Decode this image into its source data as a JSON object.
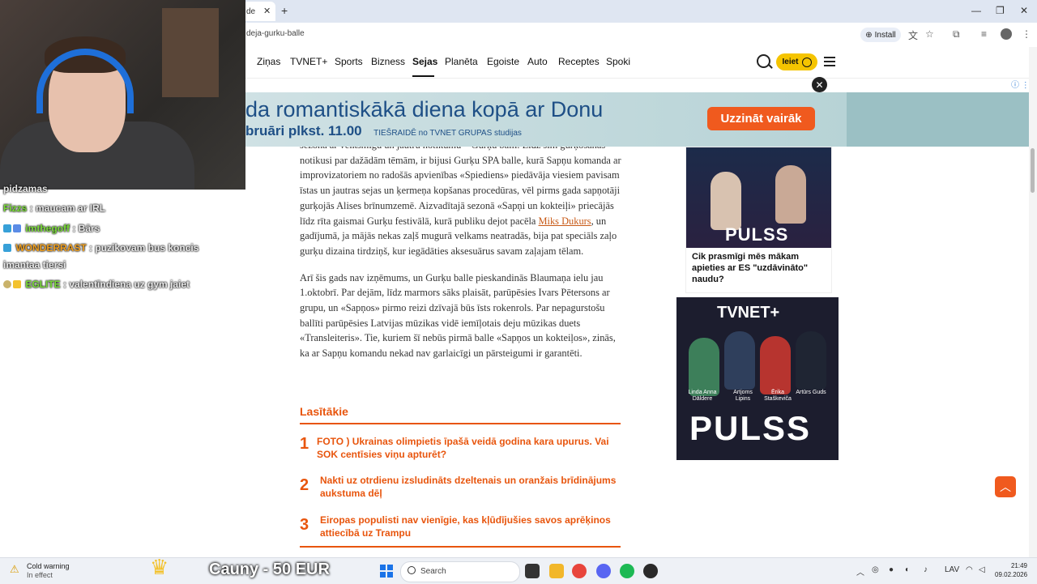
{
  "browser": {
    "tab_title": "de",
    "tab_close": "✕",
    "new_tab": "+",
    "url": "deja-gurku-balle",
    "install_label": "Install",
    "window_controls": [
      "—",
      "❐",
      "✕"
    ]
  },
  "nav": {
    "items": [
      "Ziņas",
      "TVNET+",
      "Sports",
      "Bizness",
      "Sejas",
      "Planēta",
      "Egoiste",
      "Auto",
      "Receptes",
      "Spoki"
    ],
    "active": "Sejas",
    "login_label": "Ieiet"
  },
  "ad_banner": {
    "title": "da romantiskākā diena kopā ar Donu",
    "date": "bruāri plkst. 11.00",
    "live_text": "TIEŠRAIDĒ no TVNET GRUPAS studijas",
    "button": "Uzzināt vairāk",
    "close": "✕",
    "info": "ⓘ ⋮"
  },
  "article": {
    "p1_a": "sezonā ar veiksmīgu un jautru notikumu – Gurķu balli. Līdz šim gurķošanās notikusi par dažādām tēmām, ir bijusi Gurķu SPA balle, kurā Sapņu komanda ar improvizatoriem no radošās apvienības «Spiediens» piedāvāja viesiem pavisam īstas un jautras sejas un ķermeņa kopšanas procedūras, vēl pirms gada sapņotāji gurķojās Alises brīnumzemē. Aizvadītajā sezonā «Sapņi un kokteiļi» priecājās līdz rīta gaismai Gurķu festivālā, kurā publiku dejot pacēla ",
    "p1_link": "Miks Dukurs",
    "p1_b": ", un gadījumā, ja mājās nekas zaļš mugurā velkams neatradās, bija pat speciāls zaļo gurķu dizaina tirdziņš, kur iegādāties aksesuārus savam zaļajam tēlam.",
    "p2": "Arī šis gads nav izņēmums, un Gurķu balle pieskandinās Blaumaņa ielu jau 1.oktobrī. Par dejām, līdz marmors sāks plaisāt, parūpēsies Ivars Pētersons ar grupu, un «Sapņos» pirmo reizi dzīvajā būs īsts rokenrols. Par nepagurstošu ballīti parūpēsies Latvijas mūzikas vidē iemīļotais deju mūzikas duets «Transleiteris». Tie, kuriem šī nebūs pirmā balle «Sapņos un kokteiļos», zinās, ka ar Sapņu komandu nekad nav garlaicīgi un pārsteigumi ir garantēti."
  },
  "most_read": {
    "title": "Lasītākie",
    "items": [
      {
        "num": "1",
        "text": "FOTO ) Ukrainas olimpietis īpašā veidā godina kara upurus. Vai SOK centīsies viņu apturēt?"
      },
      {
        "num": "2",
        "text": "Nakti uz otrdienu izsludināts dzeltenais un oranžais brīdinājums aukstuma dēļ"
      },
      {
        "num": "3",
        "text": "Eiropas populisti nav vienīgie, kas kļūdījušies savos aprēķinos attiecībā uz Trampu"
      }
    ]
  },
  "sidebar": {
    "promo1_logo": "PULSS",
    "promo1_caption": "Cik prasmīgi mēs mākam apieties ar ES \"uzdāvināto\" naudu?",
    "promo2_logo": "TVNET+",
    "promo2_big": "PULSS",
    "cast": [
      "Linda Anna Dāldere",
      "Artjoms Lipins",
      "Ērika Staškeviča",
      "Artūrs Guds"
    ]
  },
  "stream_overlay": {
    "chat": [
      {
        "user": "",
        "text": "pidzamas",
        "color": "#e9e9e9"
      },
      {
        "user": "Fizzs",
        "text": " : maucam ar IRL",
        "color": "#7bdc3a"
      },
      {
        "user": "imthegoff",
        "text": " : Bārs",
        "color": "#7bdc3a"
      },
      {
        "user": "WONDERRAST",
        "text": " : puzikovam bus koncis",
        "color": "#f0a020"
      },
      {
        "user": "",
        "text": "imantaa tiersi",
        "color": "#e9e9e9"
      },
      {
        "user": "EGLITE",
        "text": " : valentīndiena uz gym jaiet",
        "color": "#7bdc3a"
      }
    ],
    "donation": "Cauny - 50 EUR"
  },
  "taskbar": {
    "weather_title": "Cold warning",
    "weather_sub": "In effect",
    "search_placeholder": "Search",
    "lang": "LAV",
    "time": "21:49",
    "date": "09.02.2026"
  },
  "colors": {
    "accent_orange": "#e8550d",
    "tvnet_yellow": "#f5c400",
    "ad_blue": "#1e4f86"
  }
}
